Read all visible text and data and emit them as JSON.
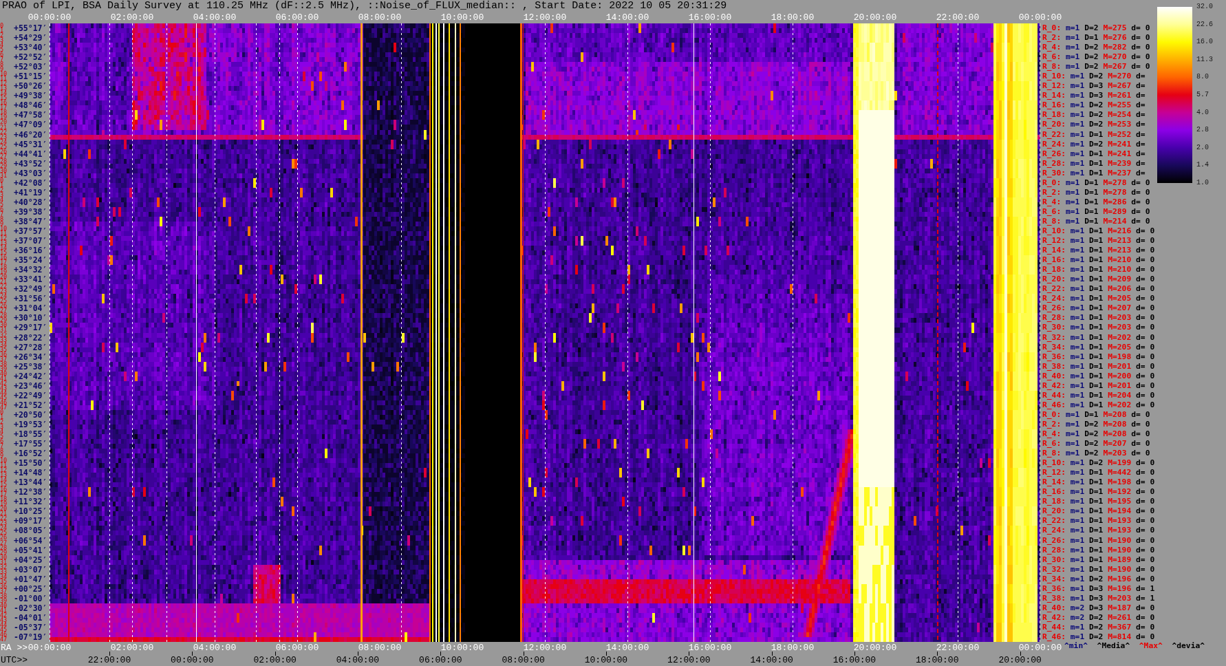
{
  "title": "PRAO of LPI, BSA Daily Survey at 110.25 MHz (dF::2.5 MHz), ::Noise_of_FLUX_median:: , Start Date: 2022 10 05 20:31:29",
  "top_axis": {
    "ticks": [
      "00:00:00",
      "02:00:00",
      "04:00:00",
      "06:00:00",
      "08:00:00",
      "10:00:00",
      "12:00:00",
      "14:00:00",
      "16:00:00",
      "18:00:00",
      "20:00:00",
      "22:00:00",
      "00:00:00"
    ]
  },
  "y_axis": [
    {
      "indices": [
        "0",
        "1"
      ],
      "label": "+55°17′"
    },
    {
      "indices": [
        "2",
        "3"
      ],
      "label": "+54°29′"
    },
    {
      "indices": [
        "4",
        "5"
      ],
      "label": "+53°40′"
    },
    {
      "indices": [
        "6",
        "7"
      ],
      "label": "+52°52′"
    },
    {
      "indices": [
        "8",
        "9"
      ],
      "label": "+52°03′"
    },
    {
      "indices": [
        "10",
        "11"
      ],
      "label": "+51°15′"
    },
    {
      "indices": [
        "12",
        "13"
      ],
      "label": "+50°26′"
    },
    {
      "indices": [
        "14",
        "15"
      ],
      "label": "+49°38′"
    },
    {
      "indices": [
        "16",
        "17"
      ],
      "label": "+48°46′"
    },
    {
      "indices": [
        "18",
        "19"
      ],
      "label": "+47°58′"
    },
    {
      "indices": [
        "20",
        "21"
      ],
      "label": "+47°09′"
    },
    {
      "indices": [
        "22",
        "23"
      ],
      "label": "+46°20′"
    },
    {
      "indices": [
        "24",
        "25"
      ],
      "label": "+45°31′"
    },
    {
      "indices": [
        "26",
        "27"
      ],
      "label": "+44°41′"
    },
    {
      "indices": [
        "28",
        "29"
      ],
      "label": "+43°52′"
    },
    {
      "indices": [
        "30",
        "31"
      ],
      "label": "+43°03′"
    },
    {
      "indices": [
        "0",
        "1"
      ],
      "label": "+42°08′"
    },
    {
      "indices": [
        "2",
        "3"
      ],
      "label": "+41°19′"
    },
    {
      "indices": [
        "4",
        "5"
      ],
      "label": "+40°28′"
    },
    {
      "indices": [
        "6",
        "7"
      ],
      "label": "+39°38′"
    },
    {
      "indices": [
        "8",
        "9"
      ],
      "label": "+38°47′"
    },
    {
      "indices": [
        "10",
        "11"
      ],
      "label": "+37°57′"
    },
    {
      "indices": [
        "12",
        "13"
      ],
      "label": "+37°07′"
    },
    {
      "indices": [
        "14",
        "15"
      ],
      "label": "+36°16′"
    },
    {
      "indices": [
        "16",
        "17"
      ],
      "label": "+35°24′"
    },
    {
      "indices": [
        "18",
        "19"
      ],
      "label": "+34°32′"
    },
    {
      "indices": [
        "20",
        "21"
      ],
      "label": "+33°41′"
    },
    {
      "indices": [
        "22",
        "23"
      ],
      "label": "+32°49′"
    },
    {
      "indices": [
        "24",
        "25"
      ],
      "label": "+31°56′"
    },
    {
      "indices": [
        "26",
        "27"
      ],
      "label": "+31°04′"
    },
    {
      "indices": [
        "28",
        "29"
      ],
      "label": "+30°10′"
    },
    {
      "indices": [
        "30",
        "31"
      ],
      "label": "+29°17′"
    },
    {
      "indices": [
        "32",
        "33"
      ],
      "label": "+28°22′"
    },
    {
      "indices": [
        "34",
        "35"
      ],
      "label": "+27°28′"
    },
    {
      "indices": [
        "36",
        "37"
      ],
      "label": "+26°34′"
    },
    {
      "indices": [
        "38",
        "39"
      ],
      "label": "+25°38′"
    },
    {
      "indices": [
        "40",
        "41"
      ],
      "label": "+24°42′"
    },
    {
      "indices": [
        "42",
        "43"
      ],
      "label": "+23°46′"
    },
    {
      "indices": [
        "44",
        "45"
      ],
      "label": "+22°49′"
    },
    {
      "indices": [
        "46",
        "47"
      ],
      "label": "+21°52′"
    },
    {
      "indices": [
        "0",
        "1"
      ],
      "label": "+20°50′"
    },
    {
      "indices": [
        "2",
        "3"
      ],
      "label": "+19°53′"
    },
    {
      "indices": [
        "4",
        "5"
      ],
      "label": "+18°55′"
    },
    {
      "indices": [
        "6",
        "7"
      ],
      "label": "+17°55′"
    },
    {
      "indices": [
        "8",
        "9"
      ],
      "label": "+16°52′"
    },
    {
      "indices": [
        "10",
        "11"
      ],
      "label": "+15°50′"
    },
    {
      "indices": [
        "12",
        "13"
      ],
      "label": "+14°48′"
    },
    {
      "indices": [
        "14",
        "15"
      ],
      "label": "+13°44′"
    },
    {
      "indices": [
        "16",
        "17"
      ],
      "label": "+12°38′"
    },
    {
      "indices": [
        "18",
        "19"
      ],
      "label": "+11°32′"
    },
    {
      "indices": [
        "20",
        "21"
      ],
      "label": "+10°25′"
    },
    {
      "indices": [
        "22",
        "23"
      ],
      "label": "+09°17′"
    },
    {
      "indices": [
        "24",
        "25"
      ],
      "label": "+08°05′"
    },
    {
      "indices": [
        "26",
        "27"
      ],
      "label": "+06°54′"
    },
    {
      "indices": [
        "28",
        "29"
      ],
      "label": "+05°41′"
    },
    {
      "indices": [
        "30",
        "31"
      ],
      "label": "+04°25′"
    },
    {
      "indices": [
        "32",
        "33"
      ],
      "label": "+03°07′"
    },
    {
      "indices": [
        "34",
        "35"
      ],
      "label": "+01°47′"
    },
    {
      "indices": [
        "36",
        "37"
      ],
      "label": "+00°25′"
    },
    {
      "indices": [
        "38",
        "39"
      ],
      "label": "-01°00′"
    },
    {
      "indices": [
        "40",
        "41"
      ],
      "label": "-02°30′"
    },
    {
      "indices": [
        "42",
        "43"
      ],
      "label": "-04°01′"
    },
    {
      "indices": [
        "44",
        "45"
      ],
      "label": "-05°37′"
    },
    {
      "indices": [
        "46",
        "47"
      ],
      "label": "-07°19′"
    }
  ],
  "row_stats": [
    {
      "row": "R_0:",
      "min": "m=1",
      "median": "D=2",
      "max": "M=275",
      "deviation": "d= 0"
    },
    {
      "row": "R_2:",
      "min": "m=1",
      "median": "D=1",
      "max": "M=276",
      "deviation": "d= 0"
    },
    {
      "row": "R_4:",
      "min": "m=1",
      "median": "D=2",
      "max": "M=282",
      "deviation": "d= 0"
    },
    {
      "row": "R_6:",
      "min": "m=1",
      "median": "D=2",
      "max": "M=270",
      "deviation": "d= 0"
    },
    {
      "row": "R_8:",
      "min": "m=1",
      "median": "D=2",
      "max": "M=267",
      "deviation": "d= 0"
    },
    {
      "row": "R_10:",
      "min": "m=1",
      "median": "D=2",
      "max": "M=270",
      "deviation": "d="
    },
    {
      "row": "R_12:",
      "min": "m=1",
      "median": "D=3",
      "max": "M=267",
      "deviation": "d="
    },
    {
      "row": "R_14:",
      "min": "m=1",
      "median": "D=3",
      "max": "M=261",
      "deviation": "d="
    },
    {
      "row": "R_16:",
      "min": "m=1",
      "median": "D=2",
      "max": "M=255",
      "deviation": "d="
    },
    {
      "row": "R_18:",
      "min": "m=1",
      "median": "D=2",
      "max": "M=254",
      "deviation": "d="
    },
    {
      "row": "R_20:",
      "min": "m=1",
      "median": "D=2",
      "max": "M=253",
      "deviation": "d="
    },
    {
      "row": "R_22:",
      "min": "m=1",
      "median": "D=1",
      "max": "M=252",
      "deviation": "d="
    },
    {
      "row": "R_24:",
      "min": "m=1",
      "median": "D=2",
      "max": "M=241",
      "deviation": "d="
    },
    {
      "row": "R_26:",
      "min": "m=1",
      "median": "D=1",
      "max": "M=241",
      "deviation": "d="
    },
    {
      "row": "R_28:",
      "min": "m=1",
      "median": "D=1",
      "max": "M=239",
      "deviation": "d="
    },
    {
      "row": "R_30:",
      "min": "m=1",
      "median": "D=1",
      "max": "M=237",
      "deviation": "d="
    },
    {
      "row": "R_0:",
      "min": "m=1",
      "median": "D=1",
      "max": "M=278",
      "deviation": "d= 0"
    },
    {
      "row": "R_2:",
      "min": "m=1",
      "median": "D=1",
      "max": "M=278",
      "deviation": "d= 0"
    },
    {
      "row": "R_4:",
      "min": "m=1",
      "median": "D=1",
      "max": "M=286",
      "deviation": "d= 0"
    },
    {
      "row": "R_6:",
      "min": "m=1",
      "median": "D=1",
      "max": "M=289",
      "deviation": "d= 0"
    },
    {
      "row": "R_8:",
      "min": "m=1",
      "median": "D=1",
      "max": "M=214",
      "deviation": "d= 0"
    },
    {
      "row": "R_10:",
      "min": "m=1",
      "median": "D=1",
      "max": "M=216",
      "deviation": "d= 0"
    },
    {
      "row": "R_12:",
      "min": "m=1",
      "median": "D=1",
      "max": "M=213",
      "deviation": "d= 0"
    },
    {
      "row": "R_14:",
      "min": "m=1",
      "median": "D=1",
      "max": "M=213",
      "deviation": "d= 0"
    },
    {
      "row": "R_16:",
      "min": "m=1",
      "median": "D=1",
      "max": "M=210",
      "deviation": "d= 0"
    },
    {
      "row": "R_18:",
      "min": "m=1",
      "median": "D=1",
      "max": "M=210",
      "deviation": "d= 0"
    },
    {
      "row": "R_20:",
      "min": "m=1",
      "median": "D=1",
      "max": "M=209",
      "deviation": "d= 0"
    },
    {
      "row": "R_22:",
      "min": "m=1",
      "median": "D=1",
      "max": "M=206",
      "deviation": "d= 0"
    },
    {
      "row": "R_24:",
      "min": "m=1",
      "median": "D=1",
      "max": "M=205",
      "deviation": "d= 0"
    },
    {
      "row": "R_26:",
      "min": "m=1",
      "median": "D=1",
      "max": "M=207",
      "deviation": "d= 0"
    },
    {
      "row": "R_28:",
      "min": "m=1",
      "median": "D=1",
      "max": "M=203",
      "deviation": "d= 0"
    },
    {
      "row": "R_30:",
      "min": "m=1",
      "median": "D=1",
      "max": "M=203",
      "deviation": "d= 0"
    },
    {
      "row": "R_32:",
      "min": "m=1",
      "median": "D=1",
      "max": "M=202",
      "deviation": "d= 0"
    },
    {
      "row": "R_34:",
      "min": "m=1",
      "median": "D=1",
      "max": "M=205",
      "deviation": "d= 0"
    },
    {
      "row": "R_36:",
      "min": "m=1",
      "median": "D=1",
      "max": "M=198",
      "deviation": "d= 0"
    },
    {
      "row": "R_38:",
      "min": "m=1",
      "median": "D=1",
      "max": "M=201",
      "deviation": "d= 0"
    },
    {
      "row": "R_40:",
      "min": "m=1",
      "median": "D=1",
      "max": "M=200",
      "deviation": "d= 0"
    },
    {
      "row": "R_42:",
      "min": "m=1",
      "median": "D=1",
      "max": "M=201",
      "deviation": "d= 0"
    },
    {
      "row": "R_44:",
      "min": "m=1",
      "median": "D=1",
      "max": "M=204",
      "deviation": "d= 0"
    },
    {
      "row": "R_46:",
      "min": "m=1",
      "median": "D=1",
      "max": "M=202",
      "deviation": "d= 0"
    },
    {
      "row": "R_0:",
      "min": "m=1",
      "median": "D=1",
      "max": "M=208",
      "deviation": "d= 0"
    },
    {
      "row": "R_2:",
      "min": "m=1",
      "median": "D=2",
      "max": "M=208",
      "deviation": "d= 0"
    },
    {
      "row": "R_4:",
      "min": "m=1",
      "median": "D=2",
      "max": "M=208",
      "deviation": "d= 0"
    },
    {
      "row": "R_6:",
      "min": "m=1",
      "median": "D=2",
      "max": "M=207",
      "deviation": "d= 0"
    },
    {
      "row": "R_8:",
      "min": "m=1",
      "median": "D=2",
      "max": "M=203",
      "deviation": "d= 0"
    },
    {
      "row": "R_10:",
      "min": "m=1",
      "median": "D=2",
      "max": "M=199",
      "deviation": "d= 0"
    },
    {
      "row": "R_12:",
      "min": "m=1",
      "median": "D=1",
      "max": "M=442",
      "deviation": "d= 0"
    },
    {
      "row": "R_14:",
      "min": "m=1",
      "median": "D=1",
      "max": "M=198",
      "deviation": "d= 0"
    },
    {
      "row": "R_16:",
      "min": "m=1",
      "median": "D=1",
      "max": "M=192",
      "deviation": "d= 0"
    },
    {
      "row": "R_18:",
      "min": "m=1",
      "median": "D=1",
      "max": "M=195",
      "deviation": "d= 0"
    },
    {
      "row": "R_20:",
      "min": "m=1",
      "median": "D=1",
      "max": "M=194",
      "deviation": "d= 0"
    },
    {
      "row": "R_22:",
      "min": "m=1",
      "median": "D=1",
      "max": "M=193",
      "deviation": "d= 0"
    },
    {
      "row": "R_24:",
      "min": "m=1",
      "median": "D=1",
      "max": "M=193",
      "deviation": "d= 0"
    },
    {
      "row": "R_26:",
      "min": "m=1",
      "median": "D=1",
      "max": "M=190",
      "deviation": "d= 0"
    },
    {
      "row": "R_28:",
      "min": "m=1",
      "median": "D=1",
      "max": "M=190",
      "deviation": "d= 0"
    },
    {
      "row": "R_30:",
      "min": "m=1",
      "median": "D=1",
      "max": "M=189",
      "deviation": "d= 0"
    },
    {
      "row": "R_32:",
      "min": "m=1",
      "median": "D=1",
      "max": "M=190",
      "deviation": "d= 0"
    },
    {
      "row": "R_34:",
      "min": "m=1",
      "median": "D=2",
      "max": "M=196",
      "deviation": "d= 0"
    },
    {
      "row": "R_36:",
      "min": "m=1",
      "median": "D=3",
      "max": "M=196",
      "deviation": "d= 1"
    },
    {
      "row": "R_38:",
      "min": "m=1",
      "median": "D=3",
      "max": "M=203",
      "deviation": "d= 1"
    },
    {
      "row": "R_40:",
      "min": "m=2",
      "median": "D=3",
      "max": "M=187",
      "deviation": "d= 0"
    },
    {
      "row": "R_42:",
      "min": "m=2",
      "median": "D=2",
      "max": "M=261",
      "deviation": "d= 0"
    },
    {
      "row": "R_44:",
      "min": "m=1",
      "median": "D=2",
      "max": "M=367",
      "deviation": "d= 0"
    },
    {
      "row": "R_46:",
      "min": "m=1",
      "median": "D=2",
      "max": "M=814",
      "deviation": "d= 0"
    }
  ],
  "color_scale": {
    "ticks": [
      "32.0",
      "22.6",
      "16.0",
      "11.3",
      "8.0",
      "5.7",
      "4.0",
      "2.8",
      "2.0",
      "1.4",
      "1.0"
    ]
  },
  "legend": [
    {
      "label": "^min^",
      "color": "#0a0a78"
    },
    {
      "label": "^Media^",
      "color": "#000000"
    },
    {
      "label": "^Max^",
      "color": "#e80000"
    },
    {
      "label": "^devia^",
      "color": "#000000"
    }
  ],
  "ra_axis": {
    "prefix": "RA >>",
    "ticks": [
      "00:00:00",
      "02:00:00",
      "04:00:00",
      "06:00:00",
      "08:00:00",
      "10:00:00",
      "12:00:00",
      "14:00:00",
      "16:00:00",
      "18:00:00",
      "20:00:00",
      "22:00:00",
      "00:00:00"
    ]
  },
  "utc_axis": {
    "prefix": "UTC>>",
    "ticks": [
      "22:00:00",
      "00:00:00",
      "02:00:00",
      "04:00:00",
      "06:00:00",
      "08:00:00",
      "10:00:00",
      "12:00:00",
      "14:00:00",
      "16:00:00",
      "18:00:00",
      "20:00:00"
    ]
  }
}
